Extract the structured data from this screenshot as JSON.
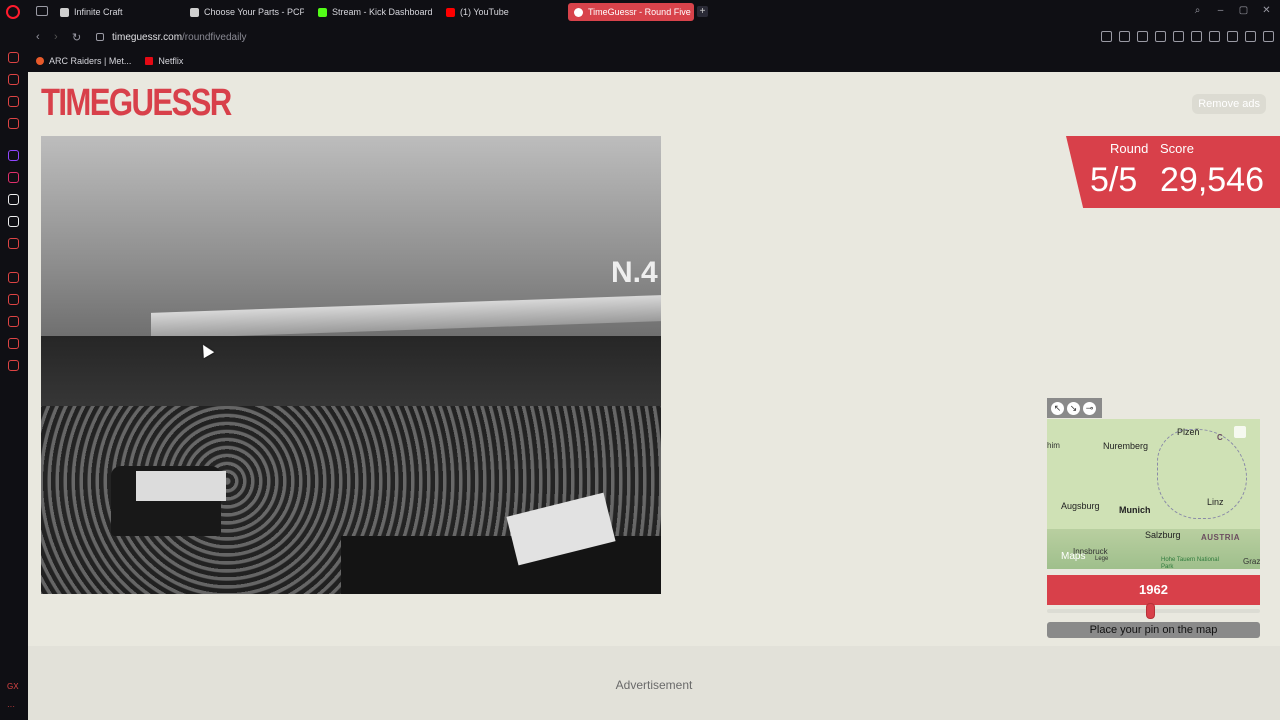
{
  "browser": {
    "tabs": [
      {
        "label": "Infinite Craft",
        "color": "#cfcfcf"
      },
      {
        "label": "Choose Your Parts - PCPa",
        "color": "#cfcfcf"
      },
      {
        "label": "Stream - Kick Dashboard",
        "color": "#53fc18"
      },
      {
        "label": "(1) YouTube",
        "color": "#ff0000"
      },
      {
        "label": "TimeGuessr - Round Five",
        "color": "#ffffff"
      }
    ],
    "url_domain": "timeguessr.com",
    "url_path": "/roundfivedaily",
    "bookmarks": [
      {
        "label": "ARC Raiders | Met...",
        "color": "#e85a2a"
      },
      {
        "label": "Netflix",
        "color": "#e50914"
      }
    ],
    "sidebar_footer": "GX"
  },
  "page": {
    "logo": "TIMEGUESSR",
    "remove_ads": "Remove ads",
    "photo_sign": "N.4",
    "round_label": "Round",
    "round_value": "5/5",
    "score_label": "Score",
    "score_value": "29,546",
    "map": {
      "labels": {
        "nuremberg": "Nuremberg",
        "plzen": "Plzeň",
        "c": "C",
        "augsburg": "Augsburg",
        "munich": "Munich",
        "linz": "Linz",
        "salzburg": "Salzburg",
        "austria": "AUSTRIA",
        "innsbruck": "Innsbruck",
        "lege": "Lege",
        "him": "him",
        "graz": "Graz",
        "park": "Hohe Tauern National Park",
        "attribution": "Maps"
      }
    },
    "year": "1962",
    "pin_prompt": "Place your pin on the map",
    "ad_label": "Advertisement"
  }
}
